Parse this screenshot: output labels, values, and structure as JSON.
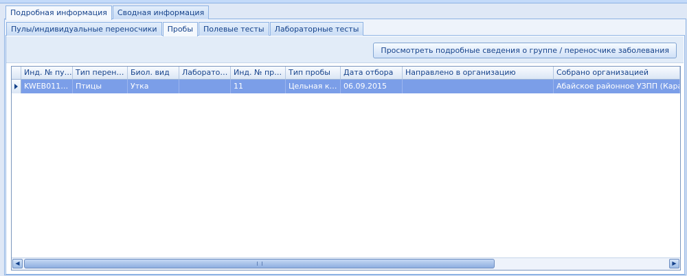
{
  "outer_tabs": [
    {
      "label": "Подробная информация",
      "active": true
    },
    {
      "label": "Сводная информация",
      "active": false
    }
  ],
  "inner_tabs": [
    {
      "label": "Пулы/индивидуальные переносчики",
      "active": false
    },
    {
      "label": "Пробы",
      "active": true
    },
    {
      "label": "Полевые тесты",
      "active": false
    },
    {
      "label": "Лабораторные тесты",
      "active": false
    }
  ],
  "toolbar": {
    "view_details_label": "Просмотреть подробные сведения о группе / переносчике заболевания"
  },
  "grid": {
    "columns": [
      "Инд. № пул...",
      "Тип перенос...",
      "Биол. вид",
      "Лаборатор...",
      "Инд. № про...",
      "Тип пробы",
      "Дата отбора",
      "Направлено в организацию",
      "Собрано организацией"
    ],
    "rows": [
      [
        "KWEB0115...",
        "Птицы",
        "Утка",
        "",
        "11",
        "Цельная кро...",
        "06.09.2015",
        "",
        "Абайское районное УЗПП (Караган"
      ]
    ]
  },
  "scrollbar": {
    "left_arrow": "◀",
    "right_arrow": "▶"
  }
}
